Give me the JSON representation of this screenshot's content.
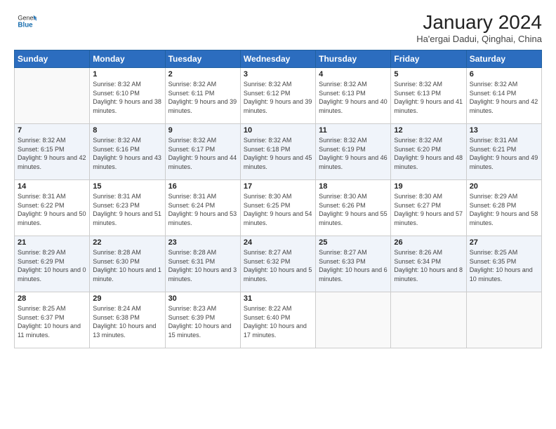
{
  "logo": {
    "line1": "General",
    "line2": "Blue"
  },
  "title": "January 2024",
  "subtitle": "Ha'ergai Dadui, Qinghai, China",
  "weekdays": [
    "Sunday",
    "Monday",
    "Tuesday",
    "Wednesday",
    "Thursday",
    "Friday",
    "Saturday"
  ],
  "weeks": [
    [
      {
        "day": "",
        "sunrise": "",
        "sunset": "",
        "daylight": ""
      },
      {
        "day": "1",
        "sunrise": "Sunrise: 8:32 AM",
        "sunset": "Sunset: 6:10 PM",
        "daylight": "Daylight: 9 hours and 38 minutes."
      },
      {
        "day": "2",
        "sunrise": "Sunrise: 8:32 AM",
        "sunset": "Sunset: 6:11 PM",
        "daylight": "Daylight: 9 hours and 39 minutes."
      },
      {
        "day": "3",
        "sunrise": "Sunrise: 8:32 AM",
        "sunset": "Sunset: 6:12 PM",
        "daylight": "Daylight: 9 hours and 39 minutes."
      },
      {
        "day": "4",
        "sunrise": "Sunrise: 8:32 AM",
        "sunset": "Sunset: 6:13 PM",
        "daylight": "Daylight: 9 hours and 40 minutes."
      },
      {
        "day": "5",
        "sunrise": "Sunrise: 8:32 AM",
        "sunset": "Sunset: 6:13 PM",
        "daylight": "Daylight: 9 hours and 41 minutes."
      },
      {
        "day": "6",
        "sunrise": "Sunrise: 8:32 AM",
        "sunset": "Sunset: 6:14 PM",
        "daylight": "Daylight: 9 hours and 42 minutes."
      }
    ],
    [
      {
        "day": "7",
        "sunrise": "Sunrise: 8:32 AM",
        "sunset": "Sunset: 6:15 PM",
        "daylight": "Daylight: 9 hours and 42 minutes."
      },
      {
        "day": "8",
        "sunrise": "Sunrise: 8:32 AM",
        "sunset": "Sunset: 6:16 PM",
        "daylight": "Daylight: 9 hours and 43 minutes."
      },
      {
        "day": "9",
        "sunrise": "Sunrise: 8:32 AM",
        "sunset": "Sunset: 6:17 PM",
        "daylight": "Daylight: 9 hours and 44 minutes."
      },
      {
        "day": "10",
        "sunrise": "Sunrise: 8:32 AM",
        "sunset": "Sunset: 6:18 PM",
        "daylight": "Daylight: 9 hours and 45 minutes."
      },
      {
        "day": "11",
        "sunrise": "Sunrise: 8:32 AM",
        "sunset": "Sunset: 6:19 PM",
        "daylight": "Daylight: 9 hours and 46 minutes."
      },
      {
        "day": "12",
        "sunrise": "Sunrise: 8:32 AM",
        "sunset": "Sunset: 6:20 PM",
        "daylight": "Daylight: 9 hours and 48 minutes."
      },
      {
        "day": "13",
        "sunrise": "Sunrise: 8:31 AM",
        "sunset": "Sunset: 6:21 PM",
        "daylight": "Daylight: 9 hours and 49 minutes."
      }
    ],
    [
      {
        "day": "14",
        "sunrise": "Sunrise: 8:31 AM",
        "sunset": "Sunset: 6:22 PM",
        "daylight": "Daylight: 9 hours and 50 minutes."
      },
      {
        "day": "15",
        "sunrise": "Sunrise: 8:31 AM",
        "sunset": "Sunset: 6:23 PM",
        "daylight": "Daylight: 9 hours and 51 minutes."
      },
      {
        "day": "16",
        "sunrise": "Sunrise: 8:31 AM",
        "sunset": "Sunset: 6:24 PM",
        "daylight": "Daylight: 9 hours and 53 minutes."
      },
      {
        "day": "17",
        "sunrise": "Sunrise: 8:30 AM",
        "sunset": "Sunset: 6:25 PM",
        "daylight": "Daylight: 9 hours and 54 minutes."
      },
      {
        "day": "18",
        "sunrise": "Sunrise: 8:30 AM",
        "sunset": "Sunset: 6:26 PM",
        "daylight": "Daylight: 9 hours and 55 minutes."
      },
      {
        "day": "19",
        "sunrise": "Sunrise: 8:30 AM",
        "sunset": "Sunset: 6:27 PM",
        "daylight": "Daylight: 9 hours and 57 minutes."
      },
      {
        "day": "20",
        "sunrise": "Sunrise: 8:29 AM",
        "sunset": "Sunset: 6:28 PM",
        "daylight": "Daylight: 9 hours and 58 minutes."
      }
    ],
    [
      {
        "day": "21",
        "sunrise": "Sunrise: 8:29 AM",
        "sunset": "Sunset: 6:29 PM",
        "daylight": "Daylight: 10 hours and 0 minutes."
      },
      {
        "day": "22",
        "sunrise": "Sunrise: 8:28 AM",
        "sunset": "Sunset: 6:30 PM",
        "daylight": "Daylight: 10 hours and 1 minute."
      },
      {
        "day": "23",
        "sunrise": "Sunrise: 8:28 AM",
        "sunset": "Sunset: 6:31 PM",
        "daylight": "Daylight: 10 hours and 3 minutes."
      },
      {
        "day": "24",
        "sunrise": "Sunrise: 8:27 AM",
        "sunset": "Sunset: 6:32 PM",
        "daylight": "Daylight: 10 hours and 5 minutes."
      },
      {
        "day": "25",
        "sunrise": "Sunrise: 8:27 AM",
        "sunset": "Sunset: 6:33 PM",
        "daylight": "Daylight: 10 hours and 6 minutes."
      },
      {
        "day": "26",
        "sunrise": "Sunrise: 8:26 AM",
        "sunset": "Sunset: 6:34 PM",
        "daylight": "Daylight: 10 hours and 8 minutes."
      },
      {
        "day": "27",
        "sunrise": "Sunrise: 8:25 AM",
        "sunset": "Sunset: 6:35 PM",
        "daylight": "Daylight: 10 hours and 10 minutes."
      }
    ],
    [
      {
        "day": "28",
        "sunrise": "Sunrise: 8:25 AM",
        "sunset": "Sunset: 6:37 PM",
        "daylight": "Daylight: 10 hours and 11 minutes."
      },
      {
        "day": "29",
        "sunrise": "Sunrise: 8:24 AM",
        "sunset": "Sunset: 6:38 PM",
        "daylight": "Daylight: 10 hours and 13 minutes."
      },
      {
        "day": "30",
        "sunrise": "Sunrise: 8:23 AM",
        "sunset": "Sunset: 6:39 PM",
        "daylight": "Daylight: 10 hours and 15 minutes."
      },
      {
        "day": "31",
        "sunrise": "Sunrise: 8:22 AM",
        "sunset": "Sunset: 6:40 PM",
        "daylight": "Daylight: 10 hours and 17 minutes."
      },
      {
        "day": "",
        "sunrise": "",
        "sunset": "",
        "daylight": ""
      },
      {
        "day": "",
        "sunrise": "",
        "sunset": "",
        "daylight": ""
      },
      {
        "day": "",
        "sunrise": "",
        "sunset": "",
        "daylight": ""
      }
    ]
  ]
}
